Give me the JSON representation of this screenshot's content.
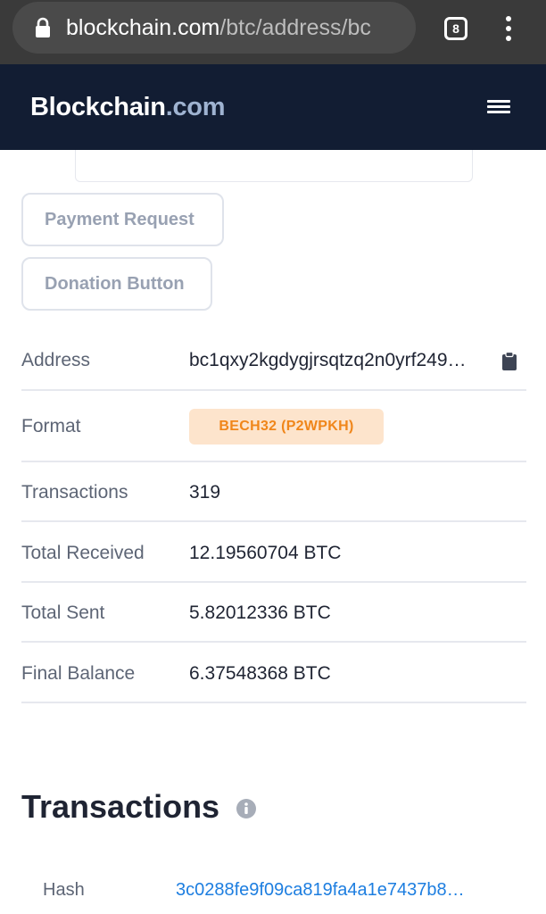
{
  "browser": {
    "url_host": "blockchain.com",
    "url_path": "/btc/address/bc",
    "tab_count": "8",
    "icons": {
      "lock": "lock-icon",
      "menu": "kebab-menu-icon"
    }
  },
  "header": {
    "brand_main": "Blockchain",
    "brand_tld": ".com",
    "menu_icon": "hamburger-menu-icon"
  },
  "actions": {
    "payment_request": "Payment Request",
    "donation_button": "Donation Button"
  },
  "address_info": {
    "address_label": "Address",
    "address_value": "bc1qxy2kgdygjrsqtzq2n0yrf249…",
    "format_label": "Format",
    "format_value": "BECH32 (P2WPKH)",
    "transactions_label": "Transactions",
    "transactions_value": "319",
    "received_label": "Total Received",
    "received_value": "12.19560704 BTC",
    "sent_label": "Total Sent",
    "sent_value": "5.82012336 BTC",
    "balance_label": "Final Balance",
    "balance_value": "6.37548368 BTC"
  },
  "transactions_section": {
    "title": "Transactions",
    "hash_label": "Hash",
    "hash_value": "3c0288fe9f09ca819fa4a1e7437b8…"
  },
  "colors": {
    "header_bg": "#121d33",
    "badge_bg": "#fde4cc",
    "badge_text": "#f0861a",
    "link": "#1d7ee0"
  }
}
